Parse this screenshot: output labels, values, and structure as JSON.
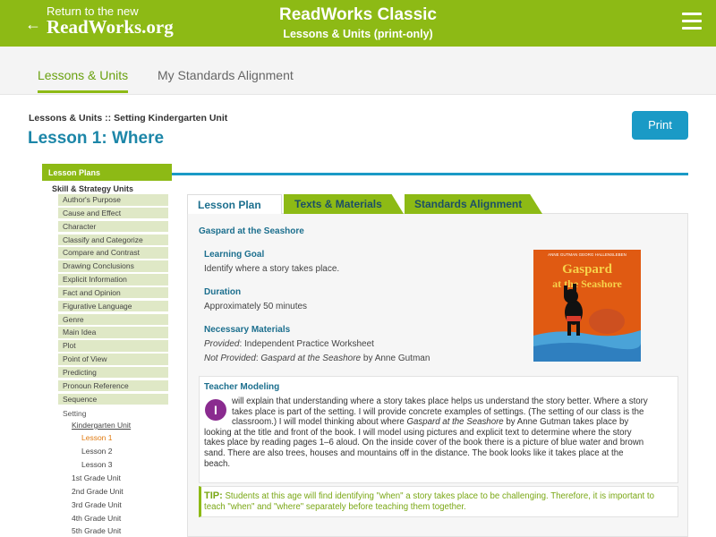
{
  "header": {
    "back_line1": "Return to the new",
    "back_line2": "ReadWorks.org",
    "title": "ReadWorks Classic",
    "subtitle": "Lessons & Units (print-only)"
  },
  "nav": {
    "tab1": "Lessons & Units",
    "tab2": "My Standards Alignment"
  },
  "breadcrumb": "Lessons & Units :: Setting Kindergarten Unit",
  "lesson_title": "Lesson 1: Where",
  "print_label": "Print",
  "sidebar": {
    "lesson_plans": "Lesson Plans",
    "skill_units": "Skill & Strategy Units",
    "skills": [
      "Author's Purpose",
      "Cause and Effect",
      "Character",
      "Classify and Categorize",
      "Compare and Contrast",
      "Drawing Conclusions",
      "Explicit Information",
      "Fact and Opinion",
      "Figurative Language",
      "Genre",
      "Main Idea",
      "Plot",
      "Point of View",
      "Predicting",
      "Pronoun Reference",
      "Sequence"
    ],
    "setting": "Setting",
    "k_unit": "Kindergarten Unit",
    "lessons": [
      "Lesson 1",
      "Lesson 2",
      "Lesson 3"
    ],
    "grade_units": [
      "1st Grade Unit",
      "2nd Grade Unit",
      "3rd Grade Unit",
      "4th Grade Unit",
      "5th Grade Unit"
    ]
  },
  "tabs": {
    "lesson_plan": "Lesson Plan",
    "texts": "Texts & Materials",
    "standards": "Standards Alignment"
  },
  "content": {
    "book_title": "Gaspard at the Seashore",
    "goal_h": "Learning Goal",
    "goal_t": "Identify where a story takes place.",
    "duration_h": "Duration",
    "duration_t": "Approximately 50 minutes",
    "materials_h": "Necessary Materials",
    "provided_label": "Provided",
    "provided_text": ": Independent Practice Worksheet",
    "not_provided_label": "Not Provided",
    "not_provided_sep": ": ",
    "not_provided_book": "Gaspard at the Seashore",
    "not_provided_author": " by Anne Gutman",
    "cover_top": "ANNE GUTMAN GEORG HALLENSLEBEN",
    "cover_title1": "Gaspard",
    "cover_title2": "at the Seashore",
    "tm_h": "Teacher Modeling",
    "dropcap": "I",
    "tm_l1": "will explain that understanding where a story takes place helps us understand the story better. Where a story",
    "tm_l2": "takes place is part of the setting. I will provide concrete examples of settings. (The setting of our class is the",
    "tm_l3a": "classroom.) I will model thinking about where ",
    "tm_l3b": "Gaspard at the Seashore",
    "tm_l3c": " by Anne Gutman takes place by",
    "tm_l4": "looking at the title and front of the book. I will model using pictures and explicit text to determine where the story",
    "tm_l5": "takes place by reading pages 1–6 aloud. On the inside cover of the book there is a picture of blue water and brown",
    "tm_l6": "sand. There are also trees, houses and mountains off in the distance. The book looks like it takes place at the",
    "tm_l7": "beach.",
    "tip_label": "TIP:",
    "tip_text": " Students at this age will find identifying \"when\" a story takes place to be challenging. Therefore, it is important to teach \"when\" and \"where\" separately before teaching them together."
  },
  "colors": {
    "brand_green": "#8dba15",
    "link_blue": "#1c86a8",
    "button_blue": "#1a9ac6",
    "active_orange": "#e07a10",
    "dropcap_purple": "#8a2b8f"
  }
}
